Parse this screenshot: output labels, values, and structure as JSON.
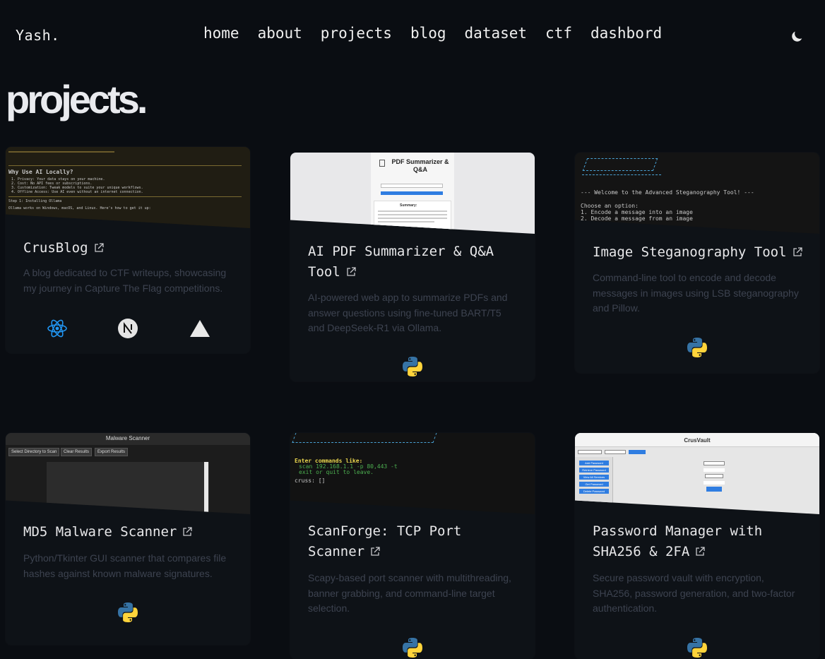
{
  "nav": {
    "logo": "Yash.",
    "links": [
      "home",
      "about",
      "projects",
      "blog",
      "dataset",
      "ctf",
      "dashbord"
    ]
  },
  "page_title": "projects.",
  "projects": [
    {
      "title": "CrusBlog",
      "description": "A blog dedicated to CTF writeups, showcasing my journey in Capture The Flag competitions.",
      "tech": [
        "react-icon",
        "nextjs-icon",
        "vercel-icon"
      ],
      "thumb": {
        "lines": [
          "Why Use AI Locally?",
          "1. Privacy: Your data stays on your machine.",
          "2. Cost: No API fees or subscriptions.",
          "3. Customization: Tweak models to suite your unique workflows.",
          "4. Offline Access: Use AI even without an internet connection.",
          "Step 1: Installing Ollama",
          "Ollama works on Windows, macOS, and Linux. Here's how to get it up:"
        ]
      }
    },
    {
      "title": "AI PDF Summarizer & Q&A Tool",
      "description": "AI-powered web app to summarize PDFs and answer questions using fine-tuned BART/T5 and DeepSeek-R1 via Ollama.",
      "tech": [
        "python-icon"
      ],
      "thumb": {
        "heading": "PDF Summarizer & Q&A",
        "summary_label": "Summary:"
      }
    },
    {
      "title": "Image Steganography Tool",
      "description": "Command-line tool to encode and decode messages in images using LSB steganography and Pillow.",
      "tech": [
        "python-icon"
      ],
      "thumb": {
        "lines": [
          "--- Welcome to the Advanced Steganography Tool! ---",
          "Choose an option:",
          "1. Encode a message into an image",
          "2. Decode a message from an image"
        ]
      }
    },
    {
      "title": "MD5 Malware Scanner",
      "description": "Python/Tkinter GUI scanner that compares file hashes against known malware signatures.",
      "tech": [
        "python-icon"
      ],
      "thumb": {
        "window_title": "Malware Scanner",
        "buttons": [
          "Select Directory to Scan",
          "Clear Results",
          "Export Results"
        ]
      }
    },
    {
      "title": "ScanForge: TCP Port Scanner",
      "description": "Scapy-based port scanner with multithreading, banner grabbing, and command-line target selection.",
      "tech": [
        "python-icon"
      ],
      "thumb": {
        "lines": [
          "Enter commands like:",
          "scan 192.168.1.1 -p 80,443 -t",
          "exit or quit to leave.",
          "cruss: []"
        ]
      }
    },
    {
      "title": "Password Manager with SHA256 & 2FA",
      "description": "Secure password vault with encryption, SHA256, password generation, and two-factor authentication.",
      "tech": [
        "python-icon"
      ],
      "thumb": {
        "window_title": "CrusVault",
        "side_buttons": [
          "Add Password",
          "Retrieve Password",
          "View All Services",
          "Get Password",
          "Delete Password"
        ]
      }
    }
  ],
  "colors": {
    "background": "#0a0d12",
    "card": "#0e1217",
    "desc_text": "#3d4350",
    "react": "#1e88e5"
  }
}
